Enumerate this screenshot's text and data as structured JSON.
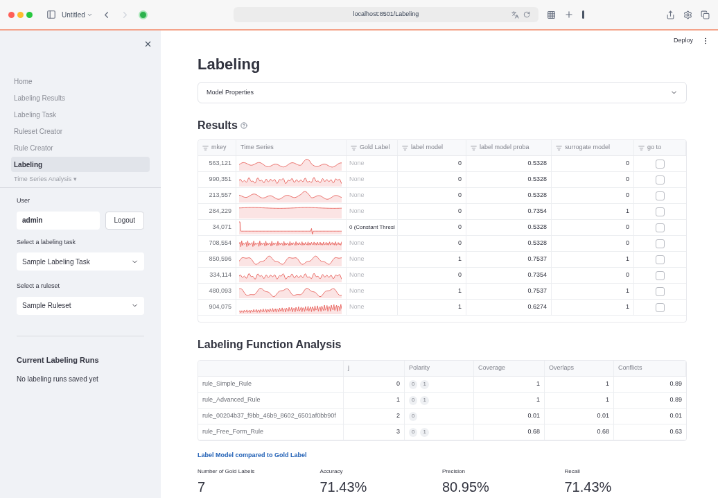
{
  "browser": {
    "tab_title": "Untitled",
    "url": "localhost:8501/Labeling"
  },
  "sidebar": {
    "items": [
      {
        "label": "Home",
        "selected": false
      },
      {
        "label": "Labeling Results",
        "selected": false
      },
      {
        "label": "Labeling Task",
        "selected": false
      },
      {
        "label": "Ruleset Creator",
        "selected": false
      },
      {
        "label": "Rule Creator",
        "selected": false
      },
      {
        "label": "Labeling",
        "selected": true
      }
    ],
    "more_item": "Time Series Analysis ▾",
    "user_label": "User",
    "user_value": "admin",
    "logout": "Logout",
    "task_label": "Select a labeling task",
    "task_value": "Sample Labeling Task",
    "ruleset_label": "Select a ruleset",
    "ruleset_value": "Sample Ruleset",
    "runs_title": "Current Labeling Runs",
    "runs_text": "No labeling runs saved yet"
  },
  "header": {
    "deploy": "Deploy"
  },
  "page_title": "Labeling",
  "expander": {
    "label": "Model Properties",
    "expanded": false
  },
  "results": {
    "title": "Results",
    "columns": [
      {
        "label": "mkey",
        "has_icon": true
      },
      {
        "label": "Time Series",
        "has_icon": false
      },
      {
        "label": "Gold Label",
        "has_icon": true
      },
      {
        "label": "label model",
        "has_icon": true
      },
      {
        "label": "label model proba",
        "has_icon": true
      },
      {
        "label": "surrogate model",
        "has_icon": true
      },
      {
        "label": "go to",
        "has_icon": true
      }
    ],
    "rows": [
      {
        "mkey": "563,121",
        "kind": "wave",
        "gold": "None",
        "gold_set": false,
        "label_model": "0",
        "proba": "0.5328",
        "surrogate": "0",
        "checked": false
      },
      {
        "mkey": "990,351",
        "kind": "jagged",
        "gold": "None",
        "gold_set": false,
        "label_model": "0",
        "proba": "0.5328",
        "surrogate": "0",
        "checked": false
      },
      {
        "mkey": "213,557",
        "kind": "wave",
        "gold": "None",
        "gold_set": false,
        "label_model": "0",
        "proba": "0.5328",
        "surrogate": "0",
        "checked": false
      },
      {
        "mkey": "284,229",
        "kind": "flat",
        "gold": "None",
        "gold_set": false,
        "label_model": "0",
        "proba": "0.7354",
        "surrogate": "1",
        "checked": false
      },
      {
        "mkey": "34,071",
        "kind": "spike",
        "gold": "0 (Constant Thresl",
        "gold_set": true,
        "label_model": "0",
        "proba": "0.5328",
        "surrogate": "0",
        "checked": false
      },
      {
        "mkey": "708,554",
        "kind": "dense",
        "gold": "None",
        "gold_set": false,
        "label_model": "0",
        "proba": "0.5328",
        "surrogate": "0",
        "checked": false
      },
      {
        "mkey": "850,596",
        "kind": "smooth",
        "gold": "None",
        "gold_set": false,
        "label_model": "1",
        "proba": "0.7537",
        "surrogate": "1",
        "checked": false
      },
      {
        "mkey": "334,114",
        "kind": "jagged",
        "gold": "None",
        "gold_set": false,
        "label_model": "0",
        "proba": "0.7354",
        "surrogate": "0",
        "checked": false
      },
      {
        "mkey": "480,093",
        "kind": "smooth",
        "gold": "None",
        "gold_set": false,
        "label_model": "1",
        "proba": "0.7537",
        "surrogate": "1",
        "checked": false
      },
      {
        "mkey": "904,075",
        "kind": "trend",
        "gold": "None",
        "gold_set": false,
        "label_model": "1",
        "proba": "0.6274",
        "surrogate": "1",
        "checked": false
      }
    ]
  },
  "lfa": {
    "title": "Labeling Function Analysis",
    "columns": [
      "j",
      "Polarity",
      "Coverage",
      "Overlaps",
      "Conflicts"
    ],
    "rows": [
      {
        "name": "rule_Simple_Rule",
        "j": "0",
        "polarity": [
          "0",
          "1"
        ],
        "coverage": "1",
        "overlaps": "1",
        "conflicts": "0.89"
      },
      {
        "name": "rule_Advanced_Rule",
        "j": "1",
        "polarity": [
          "0",
          "1"
        ],
        "coverage": "1",
        "overlaps": "1",
        "conflicts": "0.89"
      },
      {
        "name": "rule_00204b37_f9bb_46b9_8602_6501af0bb90f",
        "j": "2",
        "polarity": [
          "0"
        ],
        "coverage": "0.01",
        "overlaps": "0.01",
        "conflicts": "0.01"
      },
      {
        "name": "rule_Free_Form_Rule",
        "j": "3",
        "polarity": [
          "0",
          "1"
        ],
        "coverage": "0.68",
        "overlaps": "0.68",
        "conflicts": "0.63"
      }
    ]
  },
  "comparison": {
    "link": "Label Model compared to Gold Label",
    "metrics": [
      {
        "label": "Number of Gold Labels",
        "value": "7"
      },
      {
        "label": "Accuracy",
        "value": "71.43%"
      },
      {
        "label": "Precision",
        "value": "80.95%"
      },
      {
        "label": "Recall",
        "value": "71.43%"
      }
    ]
  }
}
